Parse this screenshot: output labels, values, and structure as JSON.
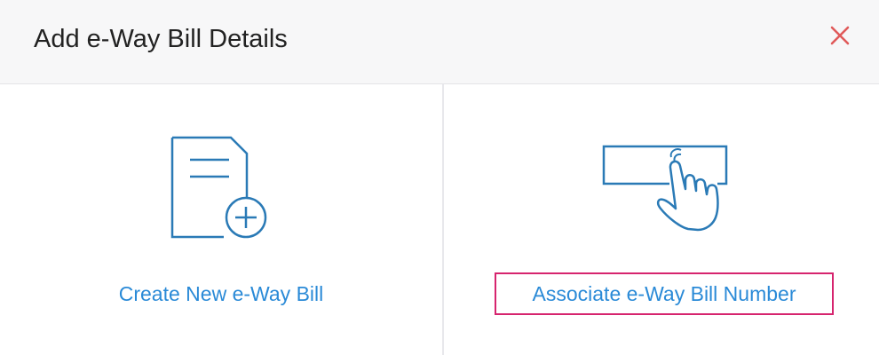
{
  "dialog": {
    "title": "Add e-Way Bill Details",
    "close_icon": "close-icon",
    "accent_color": "#2a8ad7",
    "close_color": "#e05a5a",
    "highlight_color": "#d6246e"
  },
  "options": {
    "create": {
      "label": "Create New e-Way Bill",
      "icon": "document-plus-icon"
    },
    "associate": {
      "label": "Associate e-Way Bill Number",
      "icon": "hand-pointer-icon"
    }
  }
}
